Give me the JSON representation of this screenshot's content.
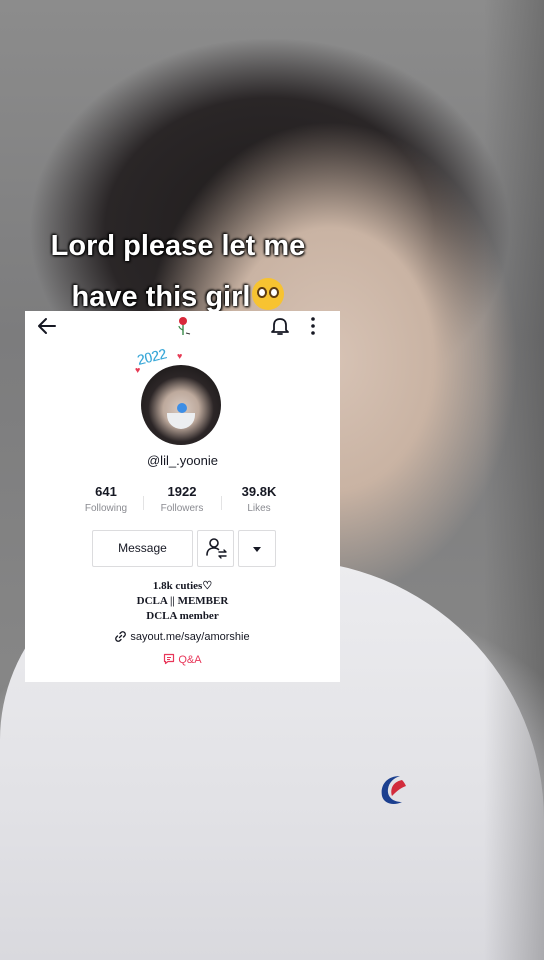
{
  "caption": {
    "line1": "Lord please let me",
    "line2": "have this girl",
    "emoji": "pleading-face"
  },
  "profile": {
    "username": "@lil_.yoonie",
    "avatar_badge": "2022",
    "stats": [
      {
        "value": "641",
        "label": "Following"
      },
      {
        "value": "1922",
        "label": "Followers"
      },
      {
        "value": "39.8K",
        "label": "Likes"
      }
    ],
    "message_label": "Message",
    "bio": [
      "1.8k cuties♡",
      "DCLA || MEMBER",
      "DCLA member"
    ],
    "link": "sayout.me/say/amorshie",
    "qa_label": "Q&A"
  },
  "colors": {
    "accent_red": "#e8375a",
    "text_dark": "#161823",
    "text_muted": "#8a8b91"
  },
  "icons": [
    "back-arrow-icon",
    "rose-icon",
    "bell-icon",
    "more-vertical-icon",
    "link-icon",
    "add-friend-icon",
    "chevron-down-icon",
    "qa-icon"
  ]
}
